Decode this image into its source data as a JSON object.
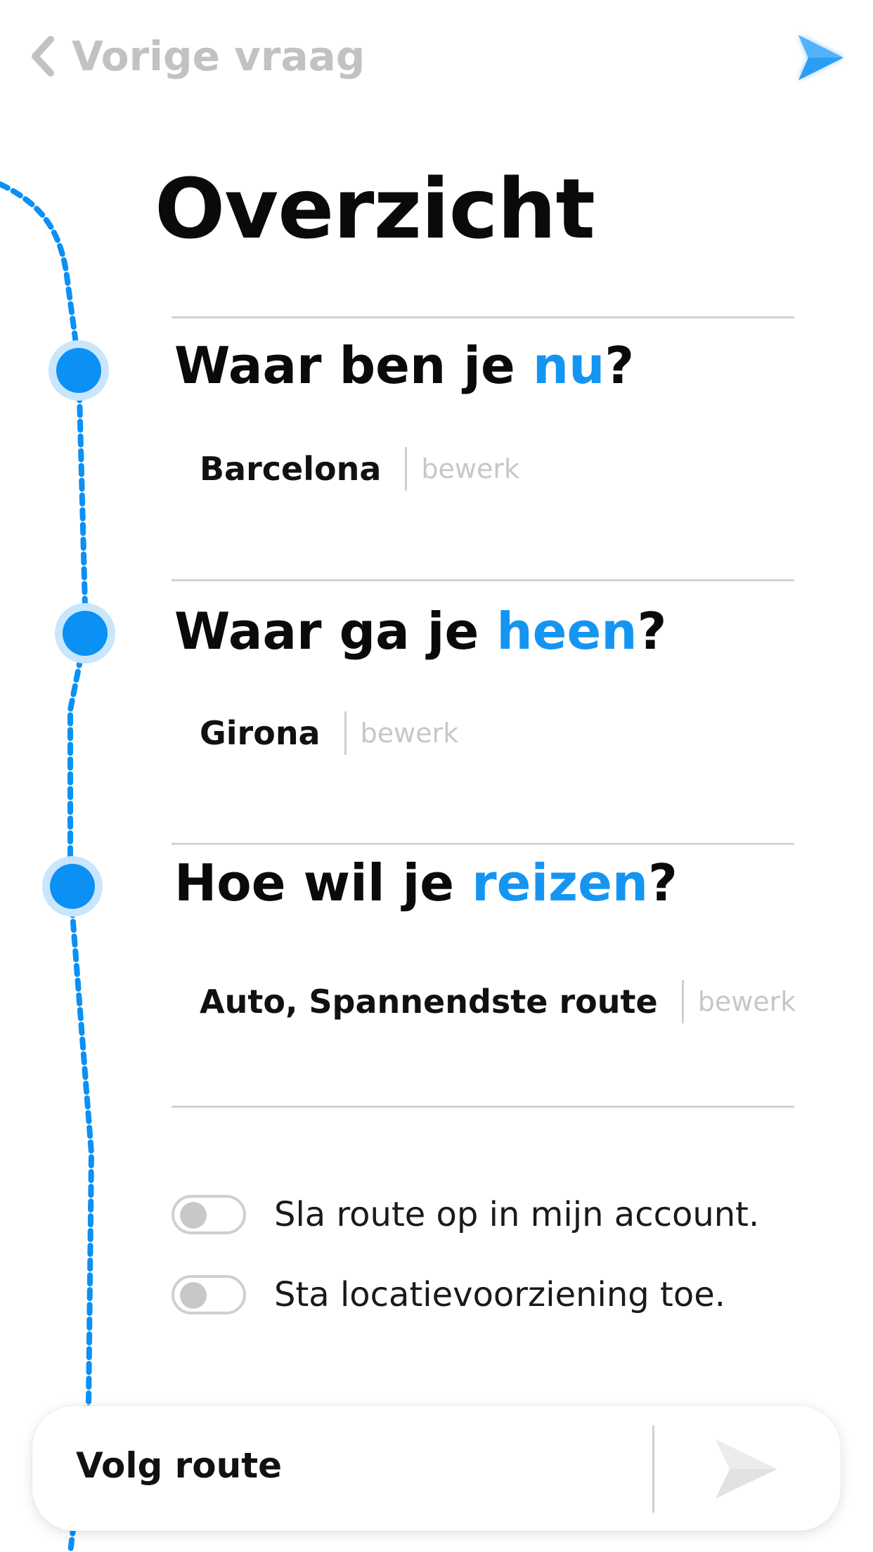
{
  "header": {
    "back_label": "Vorige vraag",
    "back_icon": "chevron-left-icon",
    "logo_icon": "play-arrow-logo"
  },
  "title": "Overzicht",
  "sections": [
    {
      "question_pre": "Waar ben je ",
      "question_accent": "nu",
      "question_post": "?",
      "answer": "Barcelona",
      "edit_label": "bewerk"
    },
    {
      "question_pre": "Waar ga je ",
      "question_accent": "heen",
      "question_post": "?",
      "answer": "Girona",
      "edit_label": "bewerk"
    },
    {
      "question_pre": "Hoe wil je ",
      "question_accent": "reizen",
      "question_post": "?",
      "answer": "Auto, Spannendste route",
      "edit_label": "bewerk"
    }
  ],
  "toggles": [
    {
      "label": "Sla route op in mijn account.",
      "on": false
    },
    {
      "label": "Sta locatievoorziening toe.",
      "on": false
    }
  ],
  "bottom_bar": {
    "label": "Volg route",
    "go_icon": "play-arrow-icon"
  },
  "colors": {
    "accent": "#1595f2",
    "node": "#0b90f4",
    "node_halo": "#c9e6fd",
    "muted": "#c2c2c2"
  }
}
